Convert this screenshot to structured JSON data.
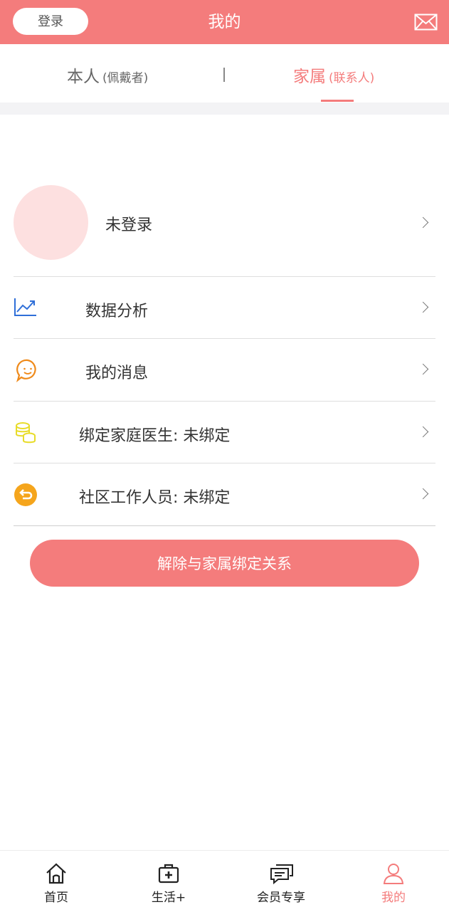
{
  "header": {
    "login_label": "登录",
    "title": "我的",
    "mail_icon": "mail-icon"
  },
  "tabs": [
    {
      "label": "本人",
      "sub": "(佩戴者)",
      "active": false
    },
    {
      "label": "家属",
      "sub": "(联系人)",
      "active": true
    }
  ],
  "profile": {
    "name": "未登录"
  },
  "menu": [
    {
      "label": "数据分析",
      "icon": "chart-icon"
    },
    {
      "label": "我的消息",
      "icon": "message-icon"
    },
    {
      "label": "绑定家庭医生: 未绑定",
      "icon": "coins-icon"
    },
    {
      "label": "社区工作人员: 未绑定",
      "icon": "return-icon"
    }
  ],
  "unbind_label": "解除与家属绑定关系",
  "tabbar": [
    {
      "label": "首页",
      "icon": "home-icon",
      "active": false
    },
    {
      "label": "生活+",
      "icon": "medkit-icon",
      "active": false
    },
    {
      "label": "会员专享",
      "icon": "chat-icon",
      "active": false
    },
    {
      "label": "我的",
      "icon": "user-icon",
      "active": true
    }
  ],
  "colors": {
    "brand": "#f47c7c",
    "avatar_bg": "#fde0e0",
    "chart_icon": "#2f6fd8",
    "message_icon": "#ef8a1a",
    "coins_icon": "#e8dc2a",
    "return_icon": "#f5a51c"
  }
}
